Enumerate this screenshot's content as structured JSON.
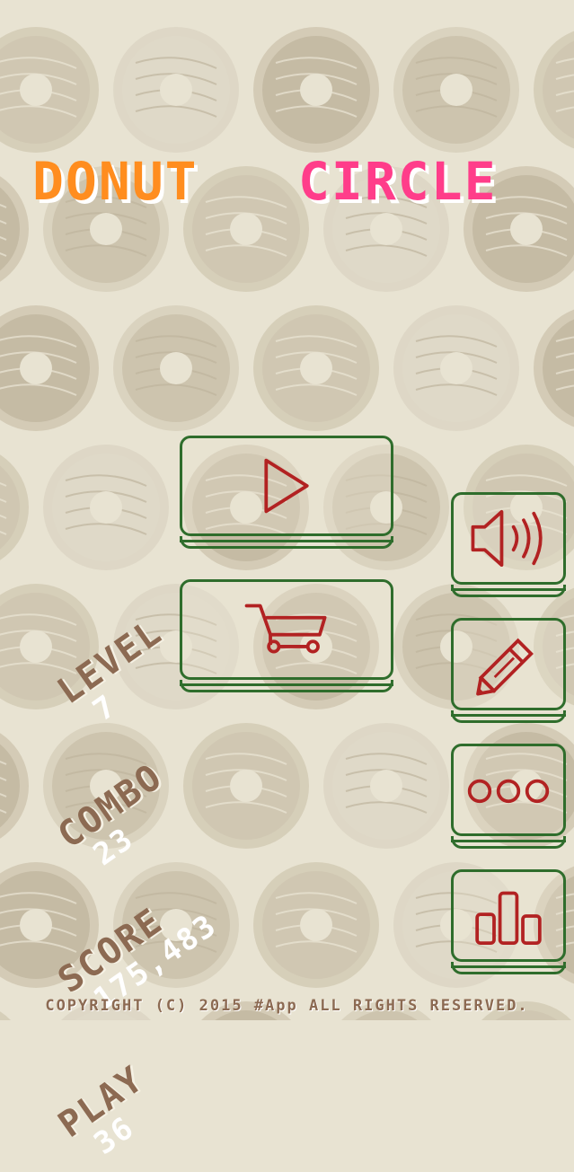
{
  "title": {
    "word1": "DONUT",
    "word2": "CIRCLE"
  },
  "buttons": [
    {
      "name": "play-button",
      "icon": "play-icon"
    },
    {
      "name": "shop-button",
      "icon": "cart-icon"
    },
    {
      "name": "sound-button",
      "icon": "speaker-icon"
    },
    {
      "name": "edit-button",
      "icon": "pencil-icon"
    },
    {
      "name": "more-button",
      "icon": "more-dots-icon"
    },
    {
      "name": "ranking-button",
      "icon": "bar-chart-icon"
    }
  ],
  "stats": {
    "level_label": "LEVEL",
    "level_value": "7",
    "combo_label": "COMBO",
    "combo_value": "23",
    "score_label": "SCORE",
    "score_value": "175,483",
    "play_label": "PLAY",
    "play_value": "36"
  },
  "footer": {
    "copyright": "COPYRIGHT (C) 2015 #App ALL RIGHTS RESERVED."
  },
  "colors": {
    "background": "#e8e3d2",
    "title_orange": "#ff8d1f",
    "title_pink": "#ff3d8a",
    "button_border": "#2f6d2c",
    "icon_red": "#b22222",
    "stat_label": "#8c6a52"
  }
}
